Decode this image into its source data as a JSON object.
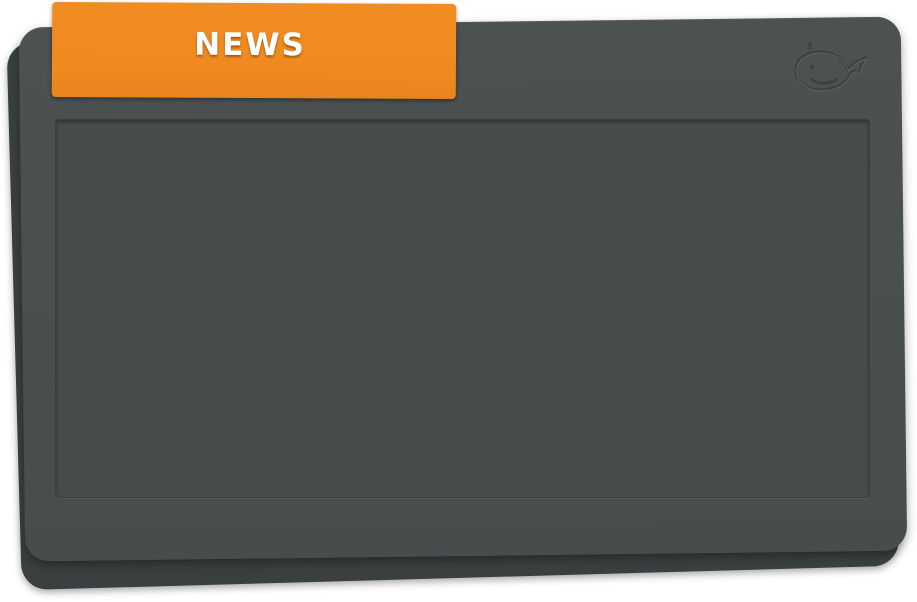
{
  "tab": {
    "label": "NEWS",
    "color": "#ee8a20"
  },
  "panel": {
    "color": "#4a504f"
  },
  "logo": {
    "icon": "whale-icon"
  }
}
